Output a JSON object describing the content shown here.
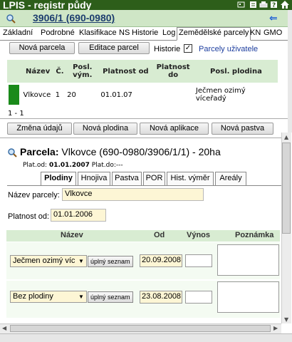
{
  "app": {
    "title": "LPIS - registr půdy",
    "icons": [
      "dots-icon",
      "list-icon",
      "print-icon",
      "help-icon",
      "home-icon"
    ]
  },
  "record": {
    "title": "3906/1 (690-0980)"
  },
  "top_tabs": [
    {
      "label": "Základní",
      "active": false
    },
    {
      "label": "Podrobné",
      "active": false
    },
    {
      "label": "Klasifikace",
      "active": false
    },
    {
      "label": "NS",
      "active": false
    },
    {
      "label": "Historie",
      "active": false
    },
    {
      "label": "Log",
      "active": false
    },
    {
      "label": "Zemědělské parcely",
      "active": true
    },
    {
      "label": "KN",
      "active": false
    },
    {
      "label": "GMO",
      "active": false
    }
  ],
  "toolbar": {
    "new_parcel": "Nová parcela",
    "edit_parcel": "Editace parcel",
    "history_label": "Historie",
    "history_checked": "✓",
    "user_parcels": "Parcely uživatele"
  },
  "parcel_list": {
    "headers": [
      "Název",
      "Č.",
      "Posl. vým.",
      "Platnost od",
      "Platnost do",
      "Posl. plodina"
    ],
    "rows": [
      {
        "name": "Vlkovce",
        "no": "1",
        "area": "20",
        "valid_from": "01.01.07",
        "valid_to": "",
        "crop": "Ječmen ozimý víceřadý"
      }
    ],
    "count": "1 - 1"
  },
  "actions": {
    "change_data": "Změna údajů",
    "new_crop": "Nová plodina",
    "new_application": "Nová aplikace",
    "new_pasture": "Nová pastva"
  },
  "detail": {
    "prefix": "Parcela:",
    "title": " Vlkovce (690-0980/3906/1/1) - 20ha",
    "plat_od_label": "Plat.od:",
    "plat_od_value": "01.01.2007",
    "plat_do": "Plat.do:---"
  },
  "sub_tabs": [
    {
      "label": "Plodiny",
      "active": true
    },
    {
      "label": "Hnojiva",
      "active": false
    },
    {
      "label": "Pastva",
      "active": false
    },
    {
      "label": "POR",
      "active": false
    },
    {
      "label": "Hist. výměr",
      "active": false
    },
    {
      "label": "Areály",
      "active": false
    }
  ],
  "form": {
    "name_label": "Název parcely:",
    "name_value": "Vlkovce",
    "valid_label": "Platnost od:",
    "valid_value": "01.01.2006"
  },
  "crops": {
    "headers": [
      "Název",
      "Od",
      "Výnos",
      "Poznámka"
    ],
    "full_list_label": "úplný seznam",
    "rows": [
      {
        "crop": "Ječmen ozimý víc",
        "from": "20.09.2008",
        "yield": "",
        "note": ""
      },
      {
        "crop": "Bez plodiny",
        "from": "23.08.2008",
        "yield": "",
        "note": ""
      }
    ]
  }
}
